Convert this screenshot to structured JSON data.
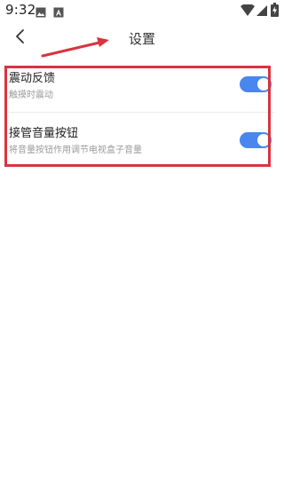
{
  "status_bar": {
    "time": "9:32"
  },
  "app_bar": {
    "title": "设置",
    "back_icon": "chevron-left-icon"
  },
  "settings": {
    "items": [
      {
        "title": "震动反馈",
        "description": "触摸时震动",
        "enabled": true
      },
      {
        "title": "接管音量按钮",
        "description": "将音量按钮作用调节电视盒子音量",
        "enabled": true
      }
    ]
  },
  "colors": {
    "toggle_on": "#4a86f0",
    "annotation": "#d9333f"
  }
}
